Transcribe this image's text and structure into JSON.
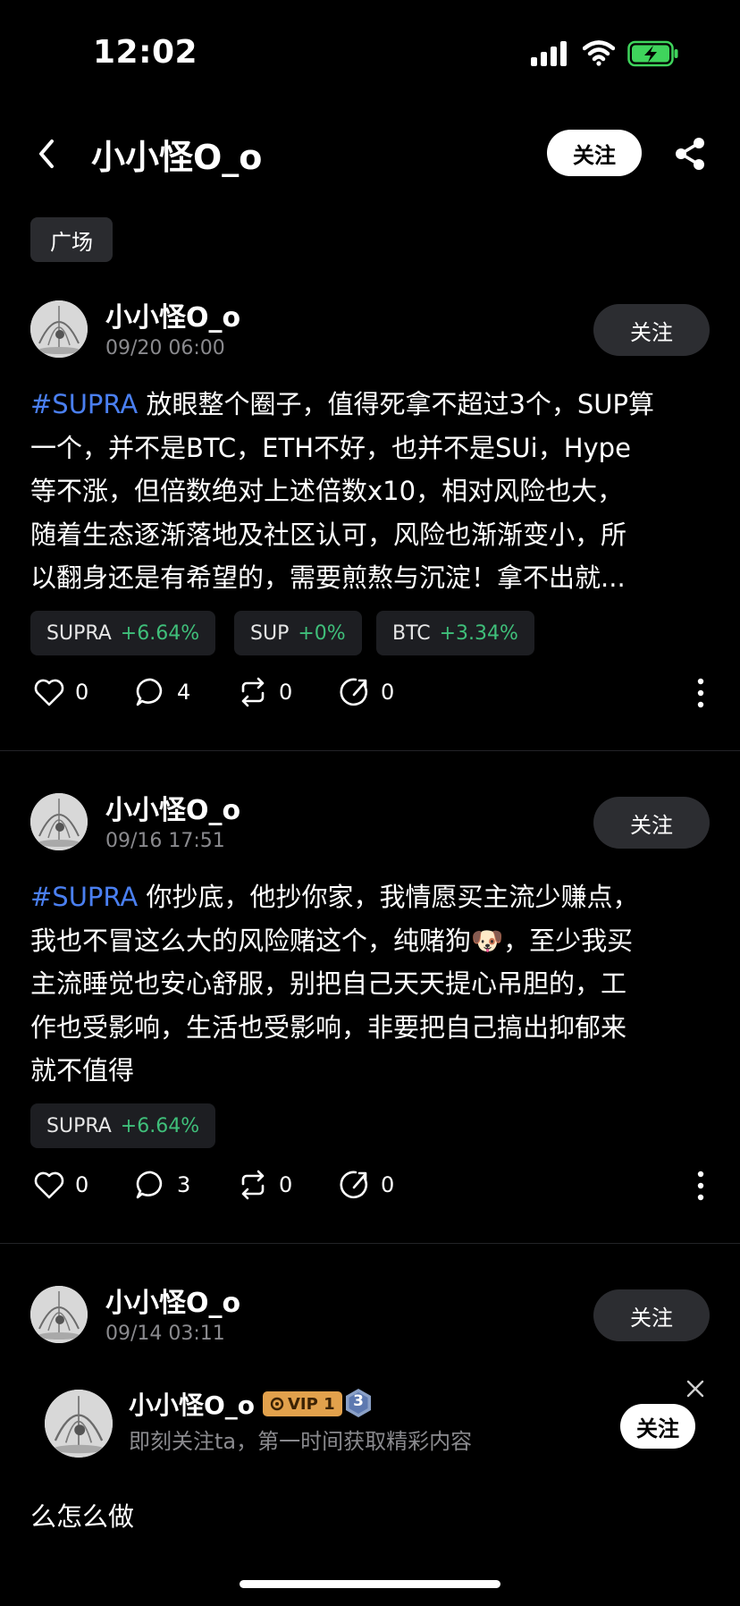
{
  "status": {
    "time": "12:02"
  },
  "header": {
    "title": "小小怪O_o",
    "follow_label": "关注"
  },
  "tab": {
    "label": "广场"
  },
  "posts": [
    {
      "name": "小小怪O_o",
      "date": "09/20 06:00",
      "follow_label": "关注",
      "lines": [
        {
          "tag": "#SUPRA",
          "text": " 放眼整个圈子，值得死拿不超过3个，SUP算"
        },
        {
          "text": "一个，并不是BTC，ETH不好，也并不是SUi，Hype"
        },
        {
          "text": "等不涨，但倍数绝对上述倍数x10，相对风险也大，"
        },
        {
          "text": "随着生态逐渐落地及社区认可，风险也渐渐变小，所"
        },
        {
          "text": "以翻身还是有希望的，需要煎熬与沉淀！拿不出就..."
        }
      ],
      "chips": [
        {
          "symbol": "SUPRA",
          "change": "+6.64%"
        },
        {
          "symbol": "SUP",
          "change": "+0%"
        },
        {
          "symbol": "BTC",
          "change": "+3.34%"
        }
      ],
      "likes": "0",
      "comments": "4",
      "reposts": "0",
      "shares": "0"
    },
    {
      "name": "小小怪O_o",
      "date": "09/16 17:51",
      "follow_label": "关注",
      "lines": [
        {
          "tag": "#SUPRA",
          "text": " 你抄底，他抄你家，我情愿买主流少赚点，"
        },
        {
          "text": "我也不冒这么大的风险赌这个，纯赌狗🐶，至少我买"
        },
        {
          "text": "主流睡觉也安心舒服，别把自己天天提心吊胆的，工"
        },
        {
          "text": "作也受影响，生活也受影响，非要把自己搞出抑郁来"
        },
        {
          "text": "就不值得"
        }
      ],
      "chips": [
        {
          "symbol": "SUPRA",
          "change": "+6.64%"
        }
      ],
      "likes": "0",
      "comments": "3",
      "reposts": "0",
      "shares": "0"
    },
    {
      "name": "小小怪O_o",
      "date": "09/14 03:11",
      "follow_label": "关注",
      "visible_line": "么怎么做"
    }
  ],
  "banner": {
    "name": "小小怪O_o",
    "vip": "VIP 1",
    "level": "3",
    "subtitle": "即刻关注ta，第一时间获取精彩内容",
    "follow_label": "关注"
  },
  "colors": {
    "hashtag": "#4a7ff0",
    "gain": "#3fbf7a",
    "vip": "#e2a14c"
  }
}
